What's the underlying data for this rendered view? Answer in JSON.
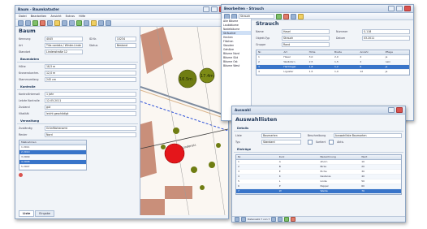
{
  "main_window": {
    "title": "Baum - Baumkataster",
    "menu": [
      "Datei",
      "Bearbeiten",
      "Ansicht",
      "Extras",
      "Hilfe"
    ],
    "form_title": "Baum",
    "top_fields": [
      {
        "label": "Kennung",
        "value": "4045"
      },
      {
        "label": "Art",
        "value": "Tilia cordata / Winter-Linde"
      },
      {
        "label": "Standort",
        "value": "Lindenstraße 12"
      }
    ],
    "right_fields": [
      {
        "label": "ID Nr.",
        "value": "10234"
      },
      {
        "label": "Status",
        "value": "Bestand"
      }
    ],
    "section_baumdaten": "Baumdaten",
    "baumdaten_fields": [
      {
        "label": "Höhe",
        "value": "18,5 m"
      },
      {
        "label": "Kronendurchm.",
        "value": "12,0 m"
      },
      {
        "label": "Stammumfang",
        "value": "245 cm"
      }
    ],
    "section_kontrolle": "Kontrolle",
    "kontrolle_fields": [
      {
        "label": "Kontrollintervall",
        "value": "1 Jahr"
      },
      {
        "label": "Letzte Kontrolle",
        "value": "12.05.2011"
      },
      {
        "label": "Zustand",
        "value": "gut"
      },
      {
        "label": "Vitalität",
        "value": "leicht geschädigt"
      }
    ],
    "section_verwaltung": "Verwaltung",
    "verwaltung_fields": [
      {
        "label": "Zuständig",
        "value": "Grünflächenamt"
      },
      {
        "label": "Revier",
        "value": "Nord"
      }
    ],
    "list_header": "Maßnahmen",
    "list_rows": [
      "1  2011",
      "2  2010",
      "3  2009",
      "4  2008",
      "5  2007"
    ],
    "selected_row": 1,
    "tabs": [
      "Liste",
      "Eingabe"
    ],
    "active_tab": 0
  },
  "map": {
    "tree_labels": [
      "16.5m",
      "17.4m"
    ],
    "road_label": "Lindenstr."
  },
  "tree_window": {
    "title": "Bearbeiten - Strauch",
    "nav_value": "Strauch",
    "tree_items": [
      "Alle Bäume",
      "Laubbäume",
      "Nadelbäume",
      "Sträucher",
      "Hecken",
      "Flächen",
      "Stauden",
      "Gehölze",
      "Bäume Nord",
      "Bäume Süd",
      "Bäume Ost",
      "Bäume West"
    ],
    "tree_selected": 3,
    "form_title": "Strauch",
    "fields": [
      {
        "label": "Name",
        "value": "Hasel"
      },
      {
        "label": "Objekt-Typ",
        "value": "Strauch"
      },
      {
        "label": "Gruppe",
        "value": "Rand"
      }
    ],
    "right_fields": [
      {
        "label": "Nummer",
        "value": "S-118"
      },
      {
        "label": "Datum",
        "value": "03.2011"
      }
    ],
    "grid_headers": [
      "Nr.",
      "Art",
      "Höhe",
      "Breite",
      "Anzahl",
      "Pflege"
    ],
    "grid_rows": [
      [
        "1",
        "Hasel",
        "3,0",
        "2,0",
        "4",
        "ja"
      ],
      [
        "2",
        "Weißdorn",
        "2,5",
        "1,5",
        "2",
        "nein"
      ],
      [
        "3",
        "Hartriegel",
        "1,8",
        "1,2",
        "6",
        "ja"
      ],
      [
        "4",
        "Liguster",
        "1,5",
        "1,0",
        "12",
        "ja"
      ]
    ],
    "grid_selected": 2
  },
  "dialog": {
    "title": "Auswahl",
    "heading": "Auswahllisten",
    "section_details": "Details",
    "fields": [
      {
        "label": "Liste",
        "value": "Baumarten"
      },
      {
        "label": "Beschreibung",
        "value": "Auswahlliste Baumarten"
      },
      {
        "label": "Typ",
        "value": "Standard"
      }
    ],
    "checkbox_labels": [
      "Sortiert",
      "Aktiv"
    ],
    "section_entries": "Einträge",
    "grid_headers": [
      "Nr.",
      "Kurz",
      "Bezeichnung",
      "Wert"
    ],
    "grid_rows": [
      [
        "1",
        "A",
        "Ahorn",
        "10"
      ],
      [
        "2",
        "B",
        "Birke",
        "20"
      ],
      [
        "3",
        "E",
        "Eiche",
        "30"
      ],
      [
        "4",
        "K",
        "Kastanie",
        "40"
      ],
      [
        "5",
        "L",
        "Linde",
        "50"
      ],
      [
        "6",
        "P",
        "Pappel",
        "60"
      ],
      [
        "7",
        "W",
        "Weide",
        "70"
      ]
    ],
    "grid_selected": 6,
    "status_text": "Datensatz 7 von 7"
  }
}
